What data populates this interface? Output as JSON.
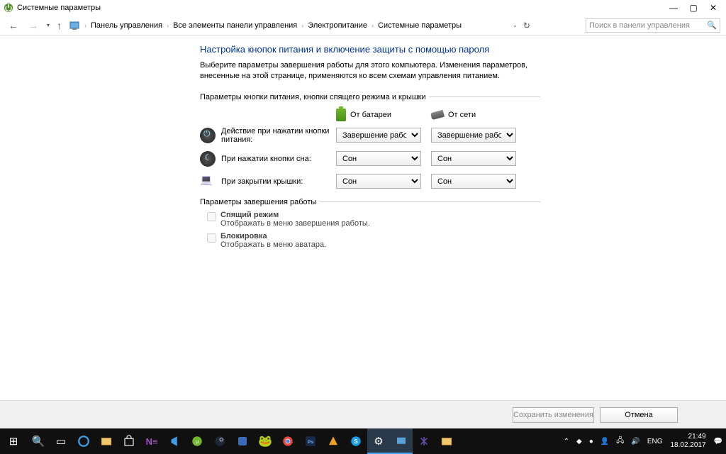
{
  "window": {
    "title": "Системные параметры"
  },
  "breadcrumb": {
    "root_icon": "monitor",
    "items": [
      "Панель управления",
      "Все элементы панели управления",
      "Электропитание",
      "Системные параметры"
    ]
  },
  "search": {
    "placeholder": "Поиск в панели управления"
  },
  "main": {
    "title": "Настройка кнопок питания и включение защиты с помощью пароля",
    "description": "Выберите параметры завершения работы для этого компьютера. Изменения параметров, внесенные на этой странице, применяются ко всем схемам управления питанием.",
    "section1_title": "Параметры кнопки питания, кнопки спящего режима и крышки",
    "col_battery": "От батареи",
    "col_ac": "От сети",
    "rows": [
      {
        "label": "Действие при нажатии кнопки питания:",
        "battery": "Завершение работы",
        "ac": "Завершение работы"
      },
      {
        "label": "При нажатии кнопки сна:",
        "battery": "Сон",
        "ac": "Сон"
      },
      {
        "label": "При закрытии крышки:",
        "battery": "Сон",
        "ac": "Сон"
      }
    ],
    "section2_title": "Параметры завершения работы",
    "checkboxes": [
      {
        "title": "Спящий режим",
        "sub": "Отображать в меню завершения работы."
      },
      {
        "title": "Блокировка",
        "sub": "Отображать в меню аватара."
      }
    ]
  },
  "buttons": {
    "save": "Сохранить изменения",
    "cancel": "Отмена"
  },
  "tray": {
    "lang": "ENG",
    "time": "21:49",
    "date": "18.02.2017"
  }
}
